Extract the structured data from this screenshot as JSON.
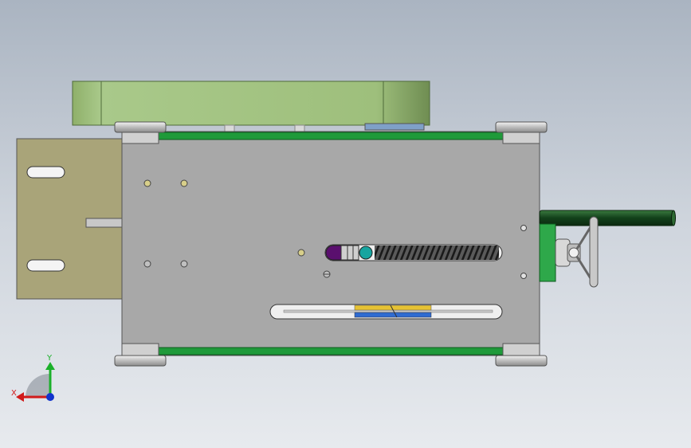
{
  "viewport": {
    "background_top": "#aab4c1",
    "background_bottom": "#e7eaee"
  },
  "model": {
    "plate_color": "#a8a8a8",
    "rail_color": "#1f9a3a",
    "bracket_color": "#a9a479",
    "top_block_color": "#9fc07d",
    "slot_color": "#f4f4f4",
    "screw_color": "#2b2b2b",
    "shaft_color": "#1d4f22",
    "handwheel_color": "#c9c9c9",
    "nut_left_color": "#5a0f6e",
    "nut_right_color": "#17a5a0",
    "gear_yellow": "#e6c233",
    "gear_blue": "#2f6bd1"
  },
  "triad": {
    "x_label": "X",
    "y_label": "Y",
    "x_color": "#d11a1a",
    "y_color": "#1bb02a",
    "z_color": "#1133cc"
  }
}
